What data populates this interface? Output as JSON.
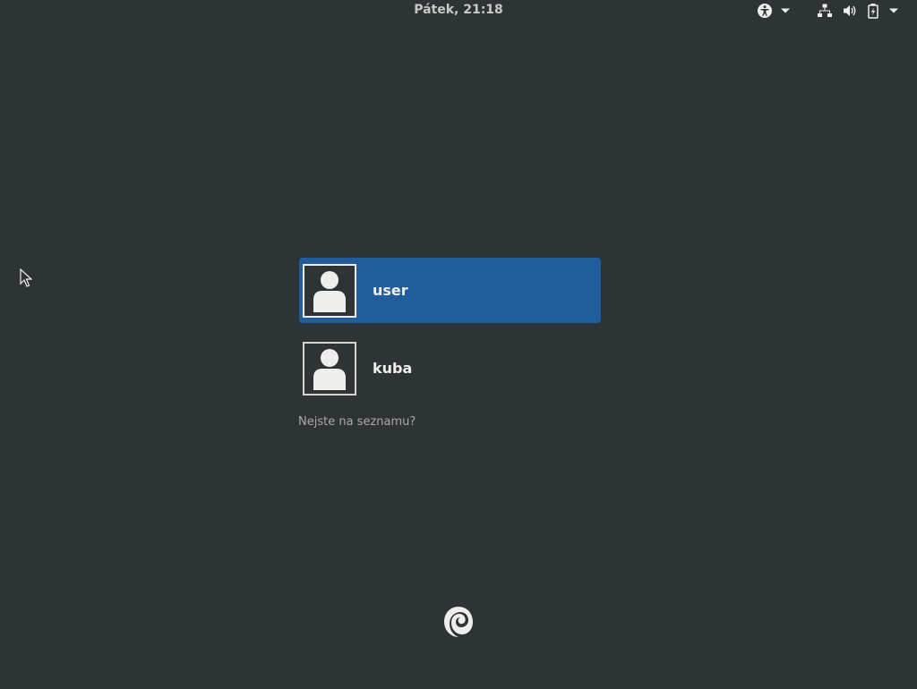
{
  "top_bar": {
    "clock": "Pátek, 21:18",
    "tray_icons": [
      "accessibility-icon",
      "chevron-down-icon",
      "network-icon",
      "volume-icon",
      "battery-icon",
      "chevron-down-icon"
    ]
  },
  "users": [
    {
      "name": "user",
      "selected": true
    },
    {
      "name": "kuba",
      "selected": false
    }
  ],
  "not_listed_label": "Nejste na seznamu?",
  "colors": {
    "background": "#2e3436",
    "selection": "#215d9c",
    "text": "#eeeeec",
    "muted_text": "#a8aaa6"
  },
  "logo_icon": "debian-swirl-icon"
}
